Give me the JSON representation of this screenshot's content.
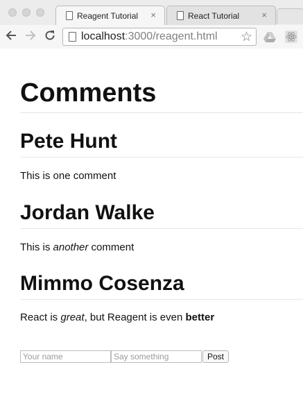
{
  "browser": {
    "tabs": [
      {
        "title": "Reagent Tutorial",
        "active": true
      },
      {
        "title": "React Tutorial",
        "active": false
      }
    ],
    "close_glyph": "×",
    "url_host": "localhost",
    "url_rest": ":3000/reagent.html",
    "icons": [
      "back-icon",
      "forward-icon",
      "reload-icon",
      "page-icon",
      "bookmark-star-icon",
      "google-drive-icon",
      "react-devtools-icon"
    ]
  },
  "page": {
    "title": "Comments",
    "comments": [
      {
        "author": "Pete Hunt",
        "text": "This is one comment"
      },
      {
        "author": "Jordan Walke",
        "text_before": "This is ",
        "text_em": "another",
        "text_after": " comment"
      },
      {
        "author": "Mimmo Cosenza",
        "text_before": "React is ",
        "text_em": "great",
        "text_mid": ", but Reagent is even ",
        "text_strong": "better"
      }
    ],
    "form": {
      "name_placeholder": "Your name",
      "name_value": "",
      "text_placeholder": "Say something",
      "text_value": "",
      "submit_label": "Post"
    }
  }
}
